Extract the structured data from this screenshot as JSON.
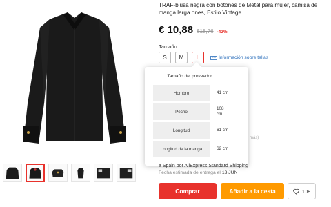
{
  "product": {
    "title": "TRAF-blusa negra con botones de Metal para mujer, camisa de manga larga ones, Estilo Vintage",
    "price": "€ 10,88",
    "old_price": "€18,76",
    "discount": "-42%"
  },
  "size_selector": {
    "label": "Tamaño:",
    "options": [
      "S",
      "M",
      "L"
    ],
    "selected": "L",
    "info_link": "Información sobre tallas",
    "info_icon": "ruler-icon"
  },
  "size_popup": {
    "title": "Tamaño del proveedor",
    "rows": [
      {
        "name": "Hombro",
        "value": "41 cm"
      },
      {
        "name": "Pecho",
        "value": "108 cm"
      },
      {
        "name": "Longitud",
        "value": "61 cm"
      },
      {
        "name": "Longitud de la manga",
        "value": "62 cm"
      }
    ]
  },
  "partial_text": {
    "mas": "más)"
  },
  "shipping": {
    "line": "a Spain por AliExpress Standard Shipping",
    "delivery_prefix": "Fecha estimada de entrega el",
    "delivery_date": "13 JUN"
  },
  "actions": {
    "buy_label": "Comprar",
    "cart_label": "Añadir a la cesta",
    "wishlist_count": "108",
    "wishlist_icon": "heart-icon"
  },
  "colors": {
    "accent_red": "#e8322c",
    "cart_orange": "#ff9a00",
    "link_blue": "#2a6ebb"
  },
  "thumbnails": {
    "count": 6,
    "selected_index": 1
  }
}
